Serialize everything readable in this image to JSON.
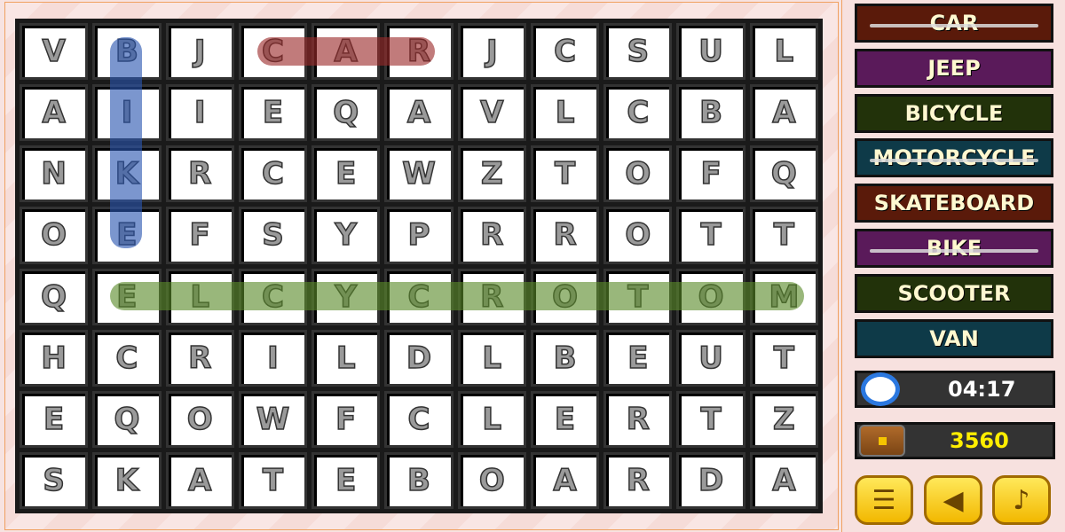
{
  "grid": [
    [
      "V",
      "B",
      "J",
      "C",
      "A",
      "R",
      "J",
      "C",
      "S",
      "U",
      "L"
    ],
    [
      "A",
      "I",
      "I",
      "E",
      "Q",
      "A",
      "V",
      "L",
      "C",
      "B",
      "A"
    ],
    [
      "N",
      "K",
      "R",
      "C",
      "E",
      "W",
      "Z",
      "T",
      "O",
      "F",
      "Q"
    ],
    [
      "O",
      "E",
      "F",
      "S",
      "Y",
      "P",
      "R",
      "R",
      "O",
      "T",
      "T"
    ],
    [
      "Q",
      "E",
      "L",
      "C",
      "Y",
      "C",
      "R",
      "O",
      "T",
      "O",
      "M"
    ],
    [
      "H",
      "C",
      "R",
      "I",
      "L",
      "D",
      "L",
      "B",
      "E",
      "U",
      "T"
    ],
    [
      "E",
      "Q",
      "O",
      "W",
      "F",
      "C",
      "L",
      "E",
      "R",
      "T",
      "Z"
    ],
    [
      "S",
      "K",
      "A",
      "T",
      "E",
      "B",
      "O",
      "A",
      "R",
      "D",
      "A"
    ]
  ],
  "found_highlights": [
    {
      "word": "CAR",
      "color": "#9b2a2a"
    },
    {
      "word": "BIKE",
      "color": "#2a55b0"
    },
    {
      "word": "MOTORCYCLE",
      "color": "#5a8a2a"
    }
  ],
  "words": [
    {
      "label": "CAR",
      "found": true,
      "color": "#5a1a0a"
    },
    {
      "label": "JEEP",
      "found": false,
      "color": "#5a1a5a"
    },
    {
      "label": "BICYCLE",
      "found": false,
      "color": "#22320a"
    },
    {
      "label": "MOTORCYCLE",
      "found": true,
      "color": "#0e3a48"
    },
    {
      "label": "SKATEBOARD",
      "found": false,
      "color": "#5a1a0a"
    },
    {
      "label": "BIKE",
      "found": true,
      "color": "#5a1a5a"
    },
    {
      "label": "SCOOTER",
      "found": false,
      "color": "#22320a"
    },
    {
      "label": "VAN",
      "found": false,
      "color": "#0e3a48"
    }
  ],
  "timer": {
    "value": "04:17",
    "icon": "clock-icon"
  },
  "score": {
    "value": "3560",
    "icon": "treasure-chest-icon"
  },
  "buttons": [
    {
      "icon": "menu-list-icon"
    },
    {
      "icon": "sound-icon"
    },
    {
      "icon": "music-icon"
    }
  ]
}
